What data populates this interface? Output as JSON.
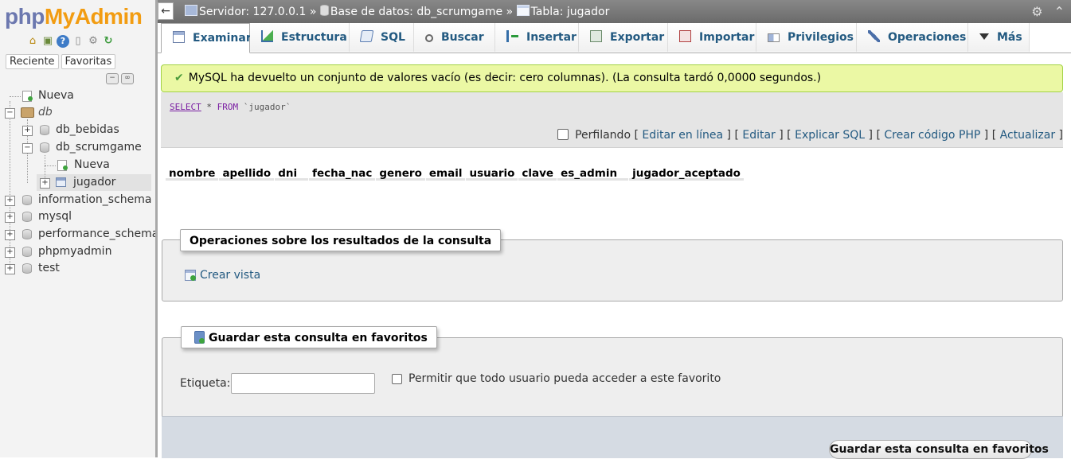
{
  "logo": {
    "php": "php",
    "my": "My",
    "admin": "Admin"
  },
  "nav": {
    "tabs": [
      "Reciente",
      "Favoritas"
    ],
    "tree": [
      {
        "label": "Nueva",
        "type": "new"
      },
      {
        "label": "db",
        "type": "group"
      },
      {
        "label": "db_bebidas",
        "type": "db"
      },
      {
        "label": "db_scrumgame",
        "type": "db"
      },
      {
        "label": "Nueva",
        "type": "new"
      },
      {
        "label": "jugador",
        "type": "table"
      },
      {
        "label": "information_schema",
        "type": "db"
      },
      {
        "label": "mysql",
        "type": "db"
      },
      {
        "label": "performance_schema",
        "type": "db"
      },
      {
        "label": "phpmyadmin",
        "type": "db"
      },
      {
        "label": "test",
        "type": "db"
      }
    ]
  },
  "breadcrumb": {
    "server": "Servidor: 127.0.0.1",
    "sep": "»",
    "database": "Base de datos: db_scrumgame",
    "table": "Tabla: jugador"
  },
  "tabs": [
    {
      "label": "Examinar",
      "icon": "browse-icon"
    },
    {
      "label": "Estructura",
      "icon": "structure-icon"
    },
    {
      "label": "SQL",
      "icon": "sql-icon"
    },
    {
      "label": "Buscar",
      "icon": "search-icon"
    },
    {
      "label": "Insertar",
      "icon": "insert-icon"
    },
    {
      "label": "Exportar",
      "icon": "export-icon"
    },
    {
      "label": "Importar",
      "icon": "import-icon"
    },
    {
      "label": "Privilegios",
      "icon": "privileges-icon"
    },
    {
      "label": "Operaciones",
      "icon": "wrench-icon"
    },
    {
      "label": "Más",
      "icon": "chevron-down-icon"
    }
  ],
  "message": {
    "text": "MySQL ha devuelto un conjunto de valores vacío (es decir: cero columnas). (La consulta tardó 0,0000 segundos.)"
  },
  "query": {
    "select": "SELECT",
    "rest": " * ",
    "from": "FROM",
    "table": " `jugador`"
  },
  "tools": {
    "profiling": "Perfilando",
    "links": [
      "Editar en línea",
      "Editar",
      "Explicar SQL",
      "Crear código PHP",
      "Actualizar"
    ]
  },
  "columns": [
    "nombre",
    "apellido",
    "dni",
    "fecha_nac",
    "genero",
    "email",
    "usuario",
    "clave",
    "es_admin",
    "jugador_aceptado"
  ],
  "ops": {
    "legend": "Operaciones sobre los resultados de la consulta",
    "create_view": "Crear vista"
  },
  "bookmark": {
    "legend": "Guardar esta consulta en favoritos",
    "label": "Etiqueta:",
    "label_value": "",
    "shared": "Permitir que todo usuario pueda acceder a este favorito",
    "button": "Guardar esta consulta en favoritos"
  }
}
